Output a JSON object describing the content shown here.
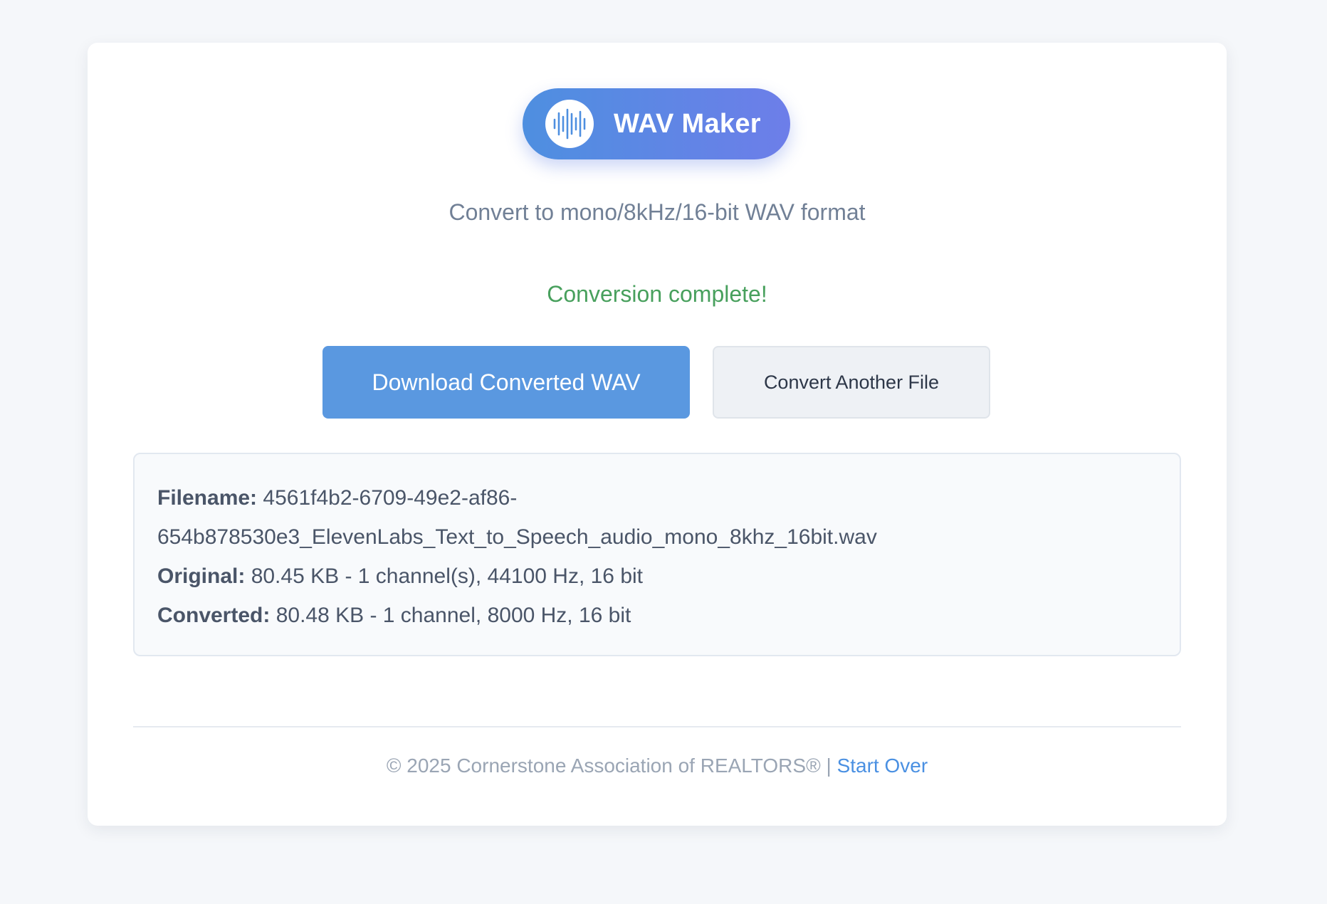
{
  "header": {
    "app_name": "WAV Maker",
    "logo_icon": "waveform-icon",
    "subtitle": "Convert to mono/8kHz/16-bit WAV format"
  },
  "status": {
    "message": "Conversion complete!",
    "color": "#48a05d"
  },
  "actions": {
    "download_label": "Download Converted WAV",
    "convert_another_label": "Convert Another File"
  },
  "file_info": {
    "filename_label": "Filename:",
    "filename_value": "4561f4b2-6709-49e2-af86-654b878530e3_ElevenLabs_Text_to_Speech_audio_mono_8khz_16bit.wav",
    "original_label": "Original:",
    "original_value": "80.45 KB - 1 channel(s), 44100 Hz, 16 bit",
    "converted_label": "Converted:",
    "converted_value": "80.48 KB - 1 channel, 8000 Hz, 16 bit"
  },
  "footer": {
    "copyright": "© 2025 Cornerstone Association of REALTORS®",
    "separator": "|",
    "start_over_label": "Start Over"
  },
  "colors": {
    "accent": "#5a98e0",
    "gradient_start": "#4e8fe0",
    "gradient_end": "#6d7ee9",
    "link": "#4a90e2"
  }
}
